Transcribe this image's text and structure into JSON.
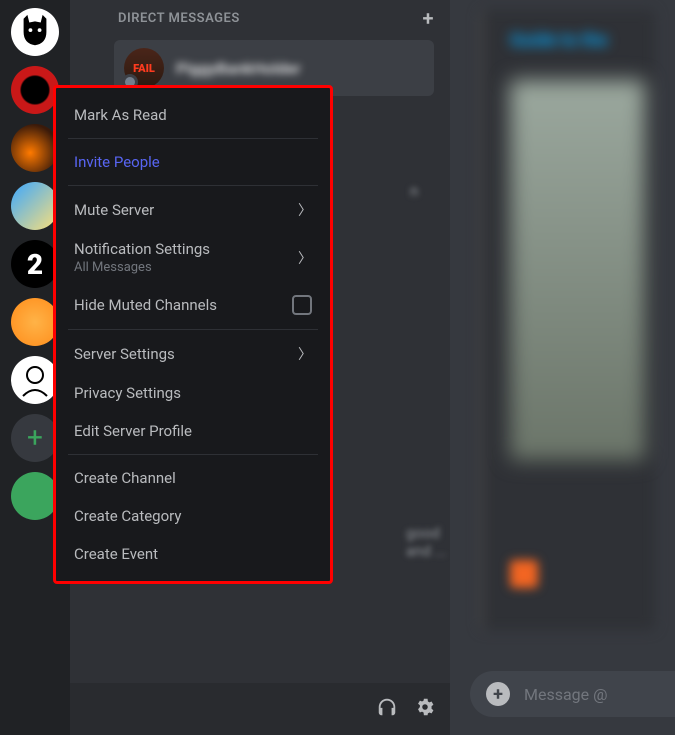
{
  "dm": {
    "header": "DIRECT MESSAGES",
    "item_name": "PiggyBankHolder",
    "avatar_text": "FAIL"
  },
  "menu": {
    "mark_read": "Mark As Read",
    "invite": "Invite People",
    "mute": "Mute Server",
    "notif": "Notification Settings",
    "notif_sub": "All Messages",
    "hide_muted": "Hide Muted Channels",
    "server_settings": "Server Settings",
    "privacy": "Privacy Settings",
    "edit_profile": "Edit Server Profile",
    "create_channel": "Create Channel",
    "create_category": "Create Category",
    "create_event": "Create Event"
  },
  "background": {
    "snippet1": "n",
    "snippet2": "good and ...",
    "embed_title": "Guide to the"
  },
  "message_input": {
    "placeholder": "Message @"
  },
  "server_labels": {
    "bw": "2"
  }
}
